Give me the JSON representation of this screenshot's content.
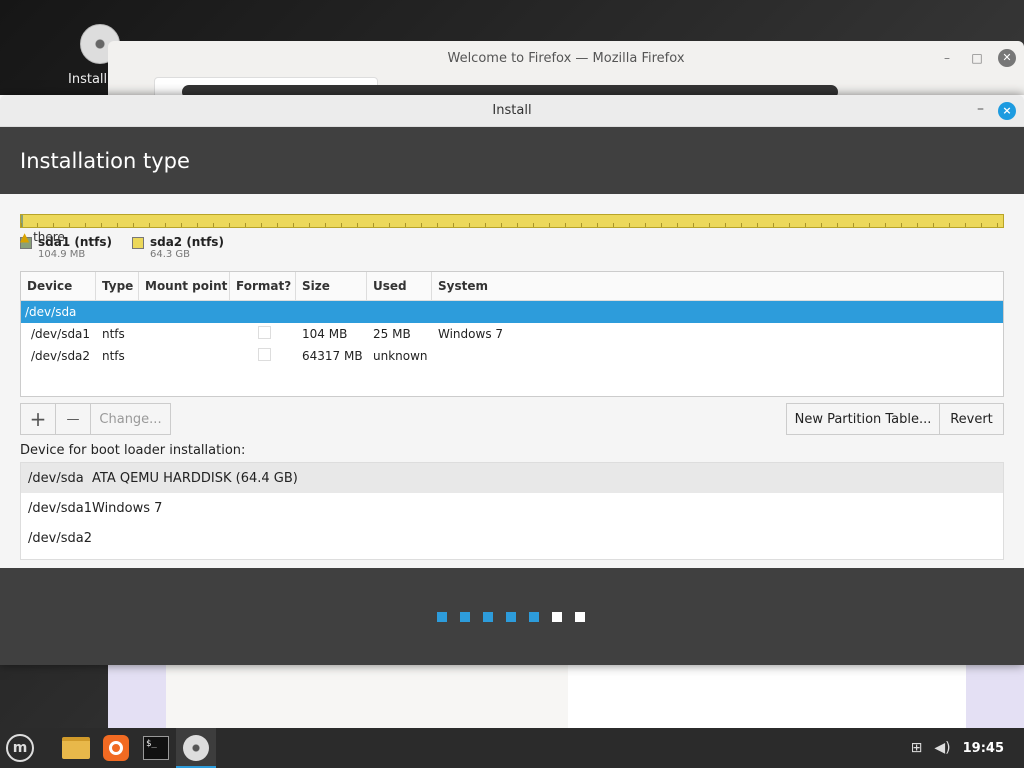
{
  "desktop": {
    "icon_label": "Install"
  },
  "firefox": {
    "title": "Welcome to Firefox — Mozilla Firefox"
  },
  "installer": {
    "title": "Install",
    "heading": "Installation type",
    "minimize": "–",
    "close": "×",
    "warning": "there",
    "legend": [
      {
        "name": "sda1 (ntfs)",
        "size": "104.9 MB",
        "color": "#8aa078"
      },
      {
        "name": "sda2 (ntfs)",
        "size": "64.3 GB",
        "color": "#ecd85a"
      }
    ],
    "table": {
      "columns": [
        "Device",
        "Type",
        "Mount point",
        "Format?",
        "Size",
        "Used",
        "System"
      ],
      "rows": [
        {
          "device": "/dev/sda",
          "type": "",
          "mount": "",
          "size": "",
          "used": "",
          "system": ""
        },
        {
          "device": "/dev/sda1",
          "type": "ntfs",
          "mount": "",
          "size": "104 MB",
          "used": "25 MB",
          "system": "Windows 7"
        },
        {
          "device": "/dev/sda2",
          "type": "ntfs",
          "mount": "",
          "size": "64317 MB",
          "used": "unknown",
          "system": ""
        }
      ]
    },
    "buttons": {
      "add": "+",
      "remove": "—",
      "change": "Change...",
      "new_partition_table": "New Partition Table...",
      "revert": "Revert"
    },
    "boot_label": "Device for boot loader installation:",
    "boot_devices": [
      {
        "device": "/dev/sda",
        "desc": "ATA QEMU HARDDISK (64.4 GB)"
      },
      {
        "device": "/dev/sda1",
        "desc": "Windows 7"
      },
      {
        "device": "/dev/sda2",
        "desc": ""
      }
    ],
    "progress_steps": {
      "total": 7,
      "completed": 5,
      "active_color": "#2d9cdb",
      "inactive_color": "#ffffff"
    }
  },
  "taskbar": {
    "clock": "19:45",
    "apps": [
      "menu-icon",
      "files-icon",
      "firefox-icon",
      "terminal-icon",
      "installer-icon"
    ]
  }
}
